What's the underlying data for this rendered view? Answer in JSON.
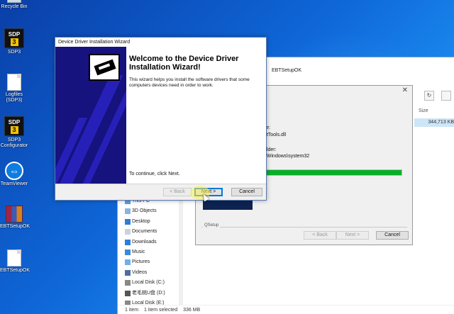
{
  "desktop": {
    "icons": [
      {
        "label": "Recycle Bin",
        "icon": "recycle-bin-icon"
      },
      {
        "label": "SDP3",
        "icon": "sdp3-icon"
      },
      {
        "label": "Logfiles (SDP3)",
        "icon": "file-icon"
      },
      {
        "label": "SDP3 Configurator",
        "icon": "sdp3-icon"
      },
      {
        "label": "TeamViewer",
        "icon": "teamviewer-icon"
      },
      {
        "label": "EBTSetupOK",
        "icon": "winrar-icon"
      },
      {
        "label": "EBTSetupOK",
        "icon": "file-icon"
      }
    ],
    "sdp_logo_text": "SDP",
    "sdp_logo_number": "3"
  },
  "explorer": {
    "title": "EBTSetupOK",
    "column_size": "Size",
    "file_size": "344,713 KB",
    "nav_items": [
      {
        "label": "This PC",
        "icon": "computer-icon"
      },
      {
        "label": "3D Objects",
        "icon": "cube-icon"
      },
      {
        "label": "Desktop",
        "icon": "desktop-icon"
      },
      {
        "label": "Documents",
        "icon": "documents-icon"
      },
      {
        "label": "Downloads",
        "icon": "download-icon"
      },
      {
        "label": "Music",
        "icon": "music-icon"
      },
      {
        "label": "Pictures",
        "icon": "pictures-icon"
      },
      {
        "label": "Videos",
        "icon": "videos-icon"
      },
      {
        "label": "Local Disk (C:)",
        "icon": "disk-icon"
      },
      {
        "label": "老毛桃U盘 (D:)",
        "icon": "disk-icon"
      },
      {
        "label": "Local Disk (E:)",
        "icon": "disk-icon"
      }
    ],
    "status": {
      "items": "1 item",
      "selected": "1 item selected",
      "size": "336 MB"
    }
  },
  "qsetup": {
    "close_symbol": "✕",
    "file_label": "ile:",
    "file_value": "mtTools.dll",
    "folder_label": "older:",
    "folder_value": ":\\Windows\\system32",
    "progress_fraction": 1.0,
    "group_label": "QSetup",
    "back_label": "< Back",
    "next_label": "Next >",
    "cancel_label": "Cancel"
  },
  "wizard": {
    "title": "Device Driver Installation Wizard",
    "heading": "Welcome to the Device Driver Installation Wizard!",
    "description": "This wizard helps you install the software drivers that some computers devices need in order to work.",
    "hint": "To continue, click Next.",
    "back_label": "< Back",
    "next_label": "Next >",
    "cancel_label": "Cancel"
  },
  "colors": {
    "accent": "#0078d7",
    "progress": "#06b025",
    "banner": "#16127e"
  }
}
